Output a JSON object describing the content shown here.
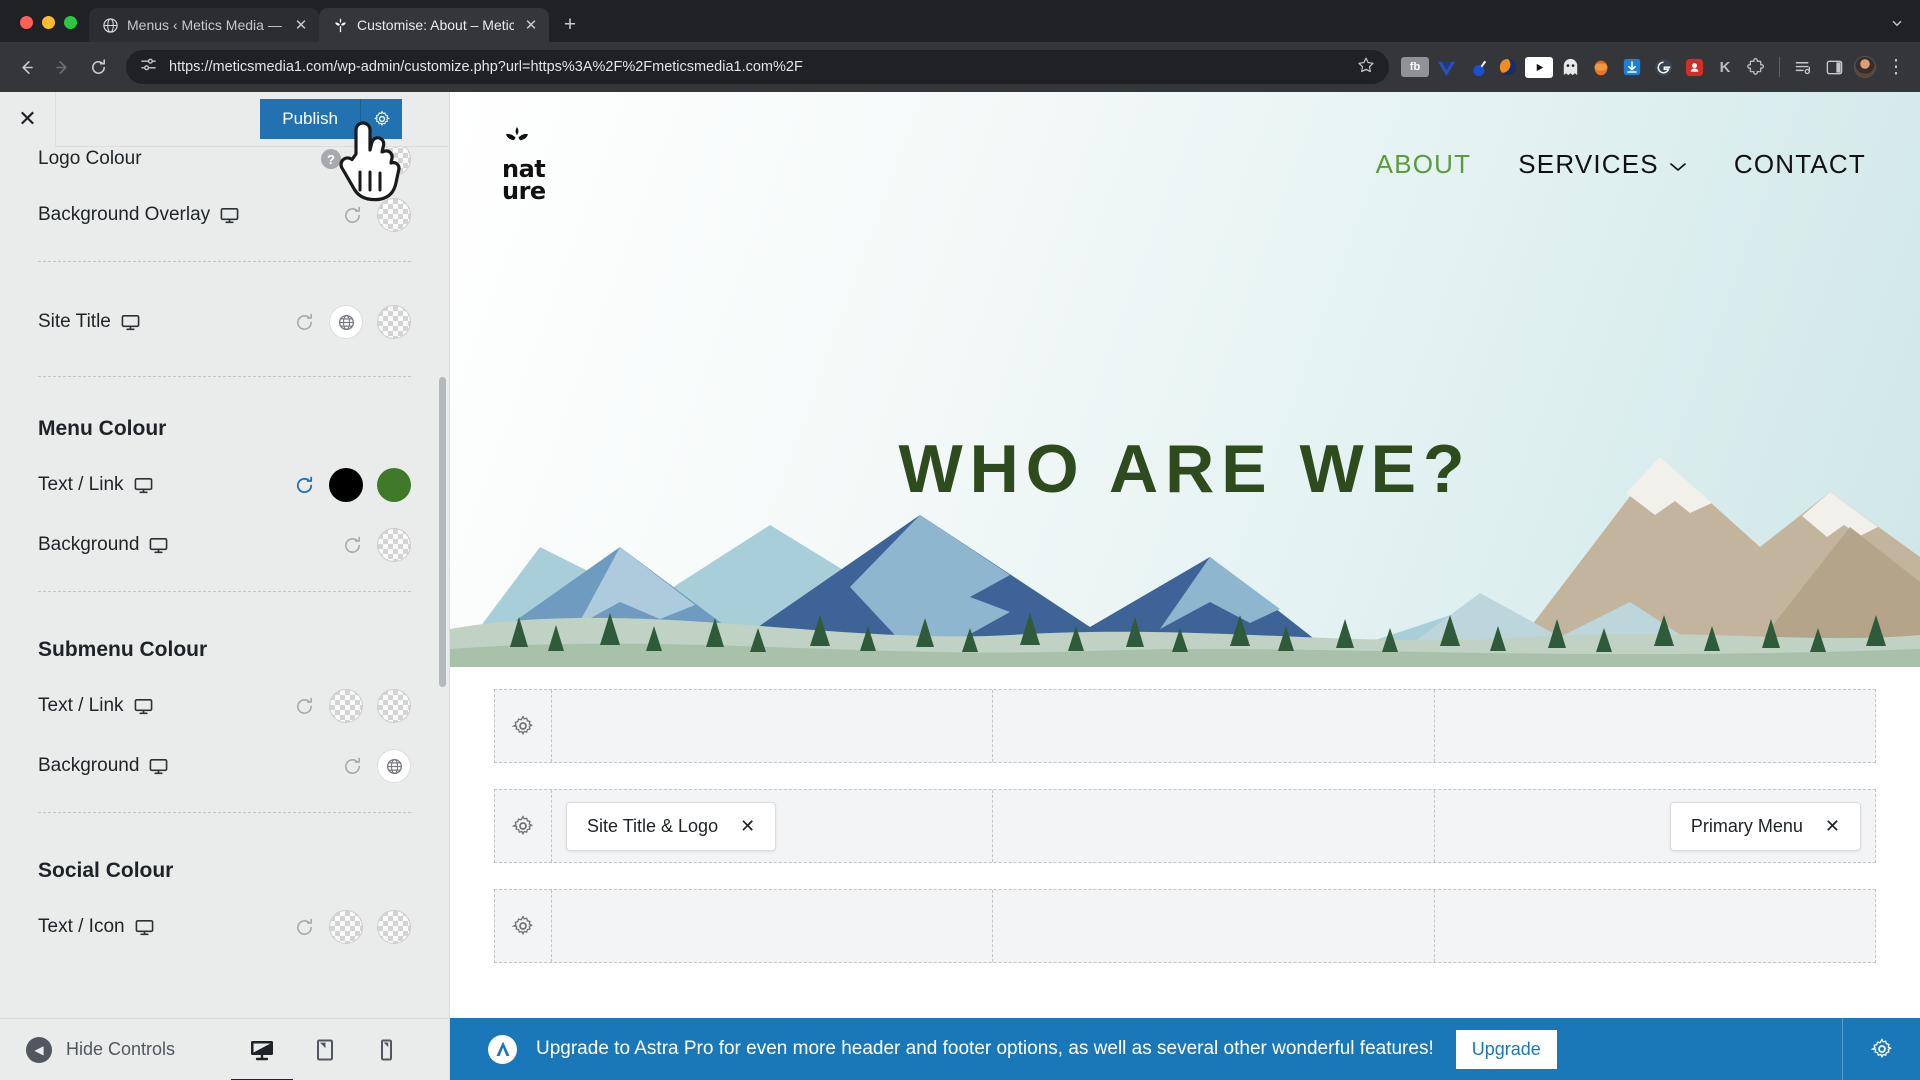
{
  "browser": {
    "tabs": [
      {
        "title": "Menus ‹ Metics Media — Wor",
        "favicon": "globe-icon",
        "active": false
      },
      {
        "title": "Customise: About – Metics M",
        "favicon": "leaf-icon",
        "active": true
      }
    ],
    "new_tab_label": "+",
    "tab_search_label": "⌄",
    "nav": {
      "back_label": "←",
      "forward_label": "→",
      "reload_label": "⟳"
    },
    "omnibox": {
      "url": "https://meticsmedia1.com/wp-admin/customize.php?url=https%3A%2F%2Fmeticsmedia1.com%2F",
      "site_info_icon": "tune-icon",
      "bookmark_icon": "star-icon"
    },
    "extensions": [
      {
        "name": "fb-pixel-helper-icon",
        "label": "fb"
      },
      {
        "name": "vue-devtools-icon",
        "label": ""
      },
      {
        "name": "wappalyzer-icon",
        "label": ""
      },
      {
        "name": "loom-icon",
        "label": ""
      },
      {
        "name": "video-downloader-icon",
        "label": "▶"
      },
      {
        "name": "ghostery-icon",
        "label": ""
      },
      {
        "name": "honey-icon",
        "label": ""
      },
      {
        "name": "downloads-icon",
        "label": "⭳"
      },
      {
        "name": "grammarly-icon",
        "label": ""
      },
      {
        "name": "lastpass-icon",
        "label": ""
      },
      {
        "name": "keeper-icon",
        "label": "K"
      },
      {
        "name": "extensions-puzzle-icon",
        "label": ""
      },
      {
        "name": "reading-list-icon",
        "label": ""
      },
      {
        "name": "side-panel-icon",
        "label": ""
      },
      {
        "name": "profile-avatar-icon",
        "label": ""
      },
      {
        "name": "chrome-menu-icon",
        "label": "⋮"
      }
    ]
  },
  "customizer": {
    "close_label": "✕",
    "publish_label": "Publish",
    "publish_gear_label": "gear-icon",
    "controls": [
      {
        "id": "logo-colour",
        "label": "Logo Colour",
        "responsive": false,
        "has_help": true,
        "help_label": "?",
        "reset_state": "inactive",
        "swatches": [
          "transparent"
        ]
      },
      {
        "id": "background-overlay",
        "label": "Background Overlay",
        "responsive": true,
        "has_help": false,
        "reset_state": "inactive",
        "swatches": [
          "transparent"
        ]
      },
      {
        "id": "site-title",
        "label": "Site Title",
        "responsive": true,
        "has_help": false,
        "reset_state": "inactive",
        "swatches": [
          "globe",
          "transparent"
        ]
      }
    ],
    "sections": [
      {
        "id": "menu-colour",
        "title": "Menu Colour",
        "rows": [
          {
            "id": "menu-text-link",
            "label": "Text / Link",
            "responsive": true,
            "reset_state": "active",
            "swatches": [
              "#000000",
              "#3f7a2b"
            ]
          },
          {
            "id": "menu-background",
            "label": "Background",
            "responsive": true,
            "reset_state": "inactive",
            "swatches": [
              "transparent"
            ]
          }
        ]
      },
      {
        "id": "submenu-colour",
        "title": "Submenu Colour",
        "rows": [
          {
            "id": "submenu-text-link",
            "label": "Text / Link",
            "responsive": true,
            "reset_state": "inactive",
            "swatches": [
              "transparent",
              "transparent"
            ]
          },
          {
            "id": "submenu-background",
            "label": "Background",
            "responsive": true,
            "reset_state": "inactive",
            "swatches": [
              "globe"
            ]
          }
        ]
      },
      {
        "id": "social-colour",
        "title": "Social Colour",
        "rows": [
          {
            "id": "social-text-icon",
            "label": "Text / Icon",
            "responsive": true,
            "reset_state": "inactive",
            "swatches": [
              "transparent",
              "transparent"
            ]
          }
        ]
      }
    ],
    "footer": {
      "hide_controls_label": "Hide Controls",
      "collapse_icon": "chevron-left-circle-icon",
      "devices": [
        {
          "id": "desktop",
          "name": "desktop-icon",
          "active": true
        },
        {
          "id": "tablet",
          "name": "tablet-icon",
          "active": false
        },
        {
          "id": "mobile",
          "name": "mobile-icon",
          "active": false
        }
      ]
    }
  },
  "preview": {
    "site": {
      "logo_text_line1": "nat",
      "logo_text_line2": "ure",
      "logo_mark": "plant-leaf-icon",
      "menu": [
        {
          "label": "ABOUT",
          "active": true,
          "has_submenu": false
        },
        {
          "label": "SERVICES",
          "active": false,
          "has_submenu": true
        },
        {
          "label": "CONTACT",
          "active": false,
          "has_submenu": false
        }
      ],
      "hero_title": "WHO ARE WE?",
      "hero_title_color": "#2e4b1e",
      "active_link_color": "#5c9a3f"
    },
    "header_builder": {
      "rows": [
        {
          "id": "above-header",
          "gear": "gear-icon",
          "items": []
        },
        {
          "id": "primary-header",
          "gear": "gear-icon",
          "items": [
            {
              "col": 0,
              "label": "Site Title & Logo",
              "remove_label": "✕"
            },
            {
              "col": 2,
              "label": "Primary Menu",
              "remove_label": "✕"
            }
          ]
        },
        {
          "id": "below-header",
          "gear": "gear-icon",
          "items": []
        }
      ],
      "column_count": 3
    },
    "astra_bar": {
      "logo": "astra-logo-icon",
      "message": "Upgrade to Astra Pro for even more header and footer options, as well as several other wonderful features!",
      "upgrade_label": "Upgrade",
      "gear_label": "gear-icon",
      "background_color": "#1b78b8"
    }
  }
}
